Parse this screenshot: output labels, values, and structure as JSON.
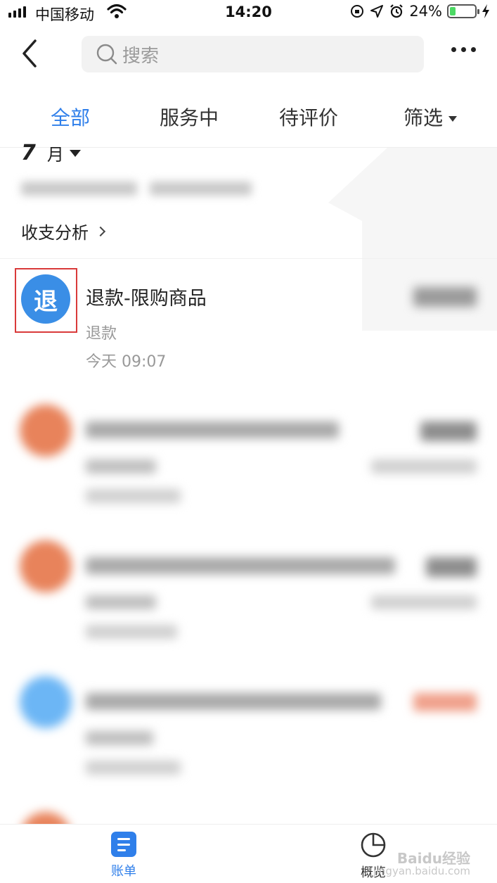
{
  "status_bar": {
    "carrier": "中国移动",
    "time": "14:20",
    "battery": "24%",
    "battery_level": 0.24
  },
  "nav": {
    "search_placeholder": "搜索"
  },
  "tabs": [
    {
      "label": "全部",
      "active": true
    },
    {
      "label": "服务中",
      "active": false
    },
    {
      "label": "待评价",
      "active": false
    },
    {
      "label": "筛选",
      "active": false
    }
  ],
  "month_header": {
    "month": "7",
    "month_suffix": "月",
    "analysis_link": "收支分析"
  },
  "transactions": [
    {
      "icon_char": "退",
      "icon_color": "#3a8ee6",
      "title": "退款-限购商品",
      "category": "退款",
      "time": "今天  09:07"
    }
  ],
  "tabbar": {
    "items": [
      {
        "label": "账单",
        "color": "#2f7fea"
      },
      {
        "label": "概览",
        "color": "#333333"
      }
    ]
  },
  "watermark": {
    "line1": "Baidu经验",
    "line2": "jingyan.baidu.com"
  },
  "colors": {
    "accent": "#2f7fea",
    "highlight": "#d93a3a"
  }
}
